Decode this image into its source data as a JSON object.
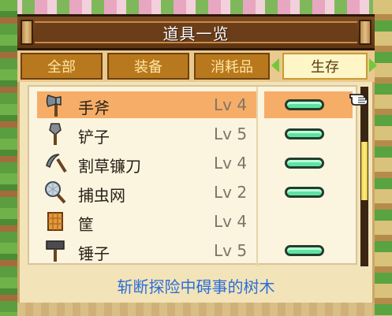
{
  "window": {
    "title": "道具一览"
  },
  "tabs": [
    {
      "label": "全部",
      "active": false
    },
    {
      "label": "装备",
      "active": false
    },
    {
      "label": "消耗品",
      "active": false
    },
    {
      "label": "生存",
      "active": true
    }
  ],
  "items": [
    {
      "icon": "axe-icon",
      "name": "手斧",
      "level": "Lv 4",
      "durability": "full",
      "selected": true
    },
    {
      "icon": "shovel-icon",
      "name": "铲子",
      "level": "Lv 5",
      "durability": "full",
      "selected": false
    },
    {
      "icon": "sickle-icon",
      "name": "割草镰刀",
      "level": "Lv 4",
      "durability": "full",
      "selected": false
    },
    {
      "icon": "bug-net-icon",
      "name": "捕虫网",
      "level": "Lv 2",
      "durability": "full",
      "selected": false
    },
    {
      "icon": "basket-icon",
      "name": "筐",
      "level": "Lv 4",
      "durability": null,
      "selected": false
    },
    {
      "icon": "hammer-icon",
      "name": "锤子",
      "level": "Lv 5",
      "durability": "full",
      "selected": false
    }
  ],
  "description": "斩断探险中碍事的树木",
  "colors": {
    "selected_row": "#f6ad67",
    "gauge_fill": "#5fe3a2",
    "description_text": "#2b6fd6",
    "active_tab": "#fff6c8"
  }
}
